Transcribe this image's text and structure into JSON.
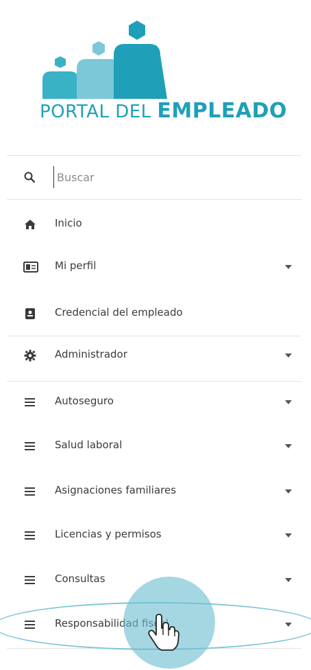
{
  "logo": {
    "text_light": "PORTAL DEL ",
    "text_bold": "EMPLEADO",
    "colors": {
      "teal": "#1fa0b8",
      "light_teal": "#7cc8d8",
      "mid_teal": "#3ab2c6"
    }
  },
  "search": {
    "placeholder": "Buscar",
    "icon": "search-icon"
  },
  "menu": {
    "items": [
      {
        "label": "Inicio",
        "icon": "home-icon",
        "has_caret": false
      },
      {
        "label": "Mi perfil",
        "icon": "id-card-icon",
        "has_caret": true
      },
      {
        "label": "Credencial del empleado",
        "icon": "badge-icon",
        "has_caret": false
      },
      {
        "label": "Administrador",
        "icon": "gear-icon",
        "has_caret": true
      },
      {
        "label": "Autoseguro",
        "icon": "menu-lines-icon",
        "has_caret": true
      },
      {
        "label": "Salud laboral",
        "icon": "menu-lines-icon",
        "has_caret": true
      },
      {
        "label": "Asignaciones familiares",
        "icon": "menu-lines-icon",
        "has_caret": true
      },
      {
        "label": "Licencias y permisos",
        "icon": "menu-lines-icon",
        "has_caret": true
      },
      {
        "label": "Consultas",
        "icon": "menu-lines-icon",
        "has_caret": true
      },
      {
        "label": "Responsabilidad fiscal",
        "icon": "menu-lines-icon",
        "has_caret": true
      }
    ]
  },
  "highlight_color": "#7cc6d6"
}
